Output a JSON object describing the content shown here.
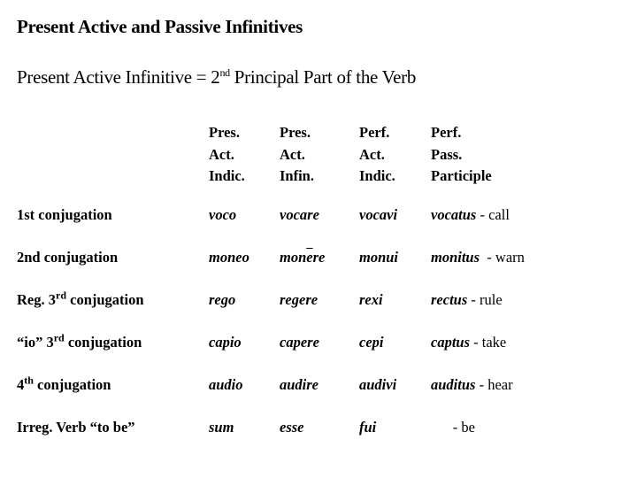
{
  "title": "Present Active and Passive Infinitives",
  "subtitle": {
    "prefix": "Present Active Infinitive = 2",
    "sup": "nd",
    "suffix": " Principal Part of the Verb"
  },
  "columns": [
    [
      "Pres.",
      "Act.",
      "Indic."
    ],
    [
      "Pres.",
      "Act.",
      "Infin."
    ],
    [
      "Perf.",
      "Act.",
      "Indic."
    ],
    [
      "Perf.",
      "Pass.",
      "Participle"
    ]
  ],
  "rows": [
    {
      "label_pre": "1st conjugation",
      "label_sup": "",
      "label_post": "",
      "pai": "voco",
      "inf_a": "vocare",
      "inf_macron": "",
      "inf_b": "",
      "perf": "vocavi",
      "ppp": "vocatus",
      "gloss": " - call"
    },
    {
      "label_pre": "2nd conjugation",
      "label_sup": "",
      "label_post": "",
      "pai": "moneo",
      "inf_a": "mon",
      "inf_macron": "e",
      "inf_b": "re",
      "perf": "monui",
      "ppp": "monitus",
      "gloss": "  - warn"
    },
    {
      "label_pre": "Reg.  3",
      "label_sup": "rd",
      "label_post": " conjugation",
      "pai": "rego",
      "inf_a": "regere",
      "inf_macron": "",
      "inf_b": "",
      "perf": "rexi",
      "ppp": "rectus",
      "gloss": " - rule"
    },
    {
      "label_pre": "“io” 3",
      "label_sup": "rd",
      "label_post": " conjugation",
      "pai": "capio",
      "inf_a": "capere",
      "inf_macron": "",
      "inf_b": "",
      "perf": "cepi",
      "ppp": "captus",
      "gloss": " - take"
    },
    {
      "label_pre": "4",
      "label_sup": "th",
      "label_post": " conjugation",
      "pai": "audio",
      "inf_a": "audire",
      "inf_macron": "",
      "inf_b": "",
      "perf": "audivi",
      "ppp": "auditus",
      "gloss": " - hear"
    },
    {
      "label_pre": "Irreg. Verb “to be”",
      "label_sup": "",
      "label_post": "",
      "pai": "sum",
      "inf_a": "esse",
      "inf_macron": "",
      "inf_b": "",
      "perf": "fui",
      "ppp": "",
      "gloss": "      - be"
    }
  ]
}
